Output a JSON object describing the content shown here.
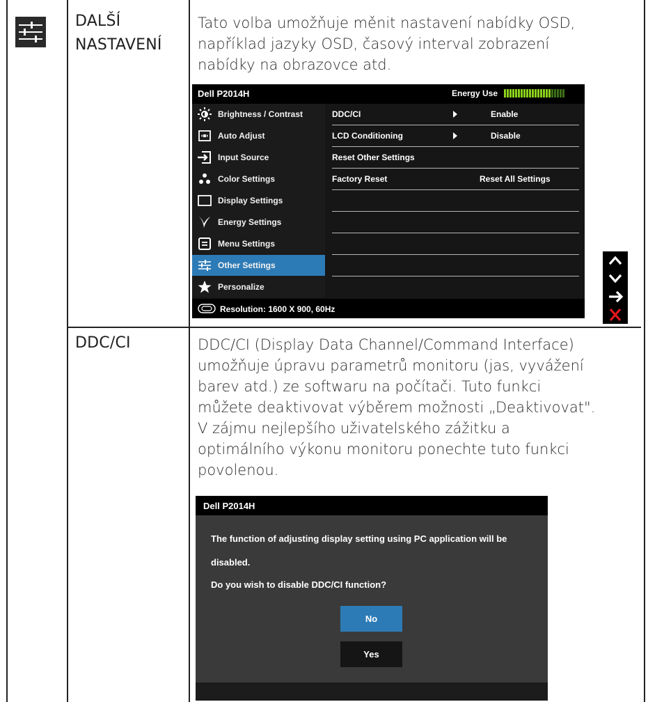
{
  "rows": [
    {
      "label": [
        "DALŠÍ",
        "NASTAVENÍ"
      ],
      "description": [
        "Tato volba umožňuje měnit nastavení nabídky OSD,",
        "například jazyky OSD, časový interval zobrazení",
        "nabídky na obrazovce atd."
      ]
    },
    {
      "label": [
        "DDC/CI"
      ],
      "description": [
        "DDC/CI (Display Data Channel/Command Interface)",
        "umožňuje úpravu parametrů monitoru (jas, vyvážení",
        "barev atd.) ze softwaru na počítači. Tuto funkci",
        "můžete deaktivovat výběrem možnosti „Deaktivovat\".",
        "V zájmu nejlepšího uživatelského zážitku a",
        "optimálního výkonu monitoru ponechte tuto funkci",
        "povolenou."
      ]
    }
  ],
  "osd": {
    "title": "Dell P2014H",
    "energy_label": "Energy Use",
    "energy_level": 0.78,
    "menu": [
      {
        "label": "Brightness / Contrast",
        "icon": "brightness-icon"
      },
      {
        "label": "Auto Adjust",
        "icon": "auto-adjust-icon"
      },
      {
        "label": "Input Source",
        "icon": "input-source-icon"
      },
      {
        "label": "Color Settings",
        "icon": "color-settings-icon"
      },
      {
        "label": "Display Settings",
        "icon": "display-settings-icon"
      },
      {
        "label": "Energy Settings",
        "icon": "energy-settings-icon"
      },
      {
        "label": "Menu Settings",
        "icon": "menu-settings-icon"
      },
      {
        "label": "Other Settings",
        "icon": "other-settings-icon",
        "selected": true
      },
      {
        "label": "Personalize",
        "icon": "star-icon"
      }
    ],
    "options": [
      {
        "name": "DDC/CI",
        "value": "Enable",
        "arrow": true
      },
      {
        "name": "LCD Conditioning",
        "value": "Disable",
        "arrow": true
      },
      {
        "name": "Reset Other Settings",
        "value": "",
        "arrow": false
      },
      {
        "name": "Factory Reset",
        "value": "Reset All Settings",
        "arrow": false
      },
      {
        "name": "",
        "value": "",
        "arrow": false
      },
      {
        "name": "",
        "value": "",
        "arrow": false
      },
      {
        "name": "",
        "value": "",
        "arrow": false
      },
      {
        "name": "",
        "value": "",
        "arrow": false
      },
      {
        "name": "",
        "value": "",
        "arrow": false
      }
    ],
    "footer": "Resolution:  1600 X 900, 60Hz",
    "side_buttons": [
      "up-icon",
      "down-icon",
      "enter-arrow-icon",
      "close-icon"
    ]
  },
  "dialog": {
    "title": "Dell P2014H",
    "message_line1": "The function of adjusting display setting using PC application will be",
    "message_line2": "disabled.",
    "question": "Do you wish to disable DDC/CI function?",
    "no_label": "No",
    "yes_label": "Yes"
  },
  "colors": {
    "selected": "#2d7bb6",
    "energy": "#8bd01c",
    "close": "#e0171c"
  }
}
